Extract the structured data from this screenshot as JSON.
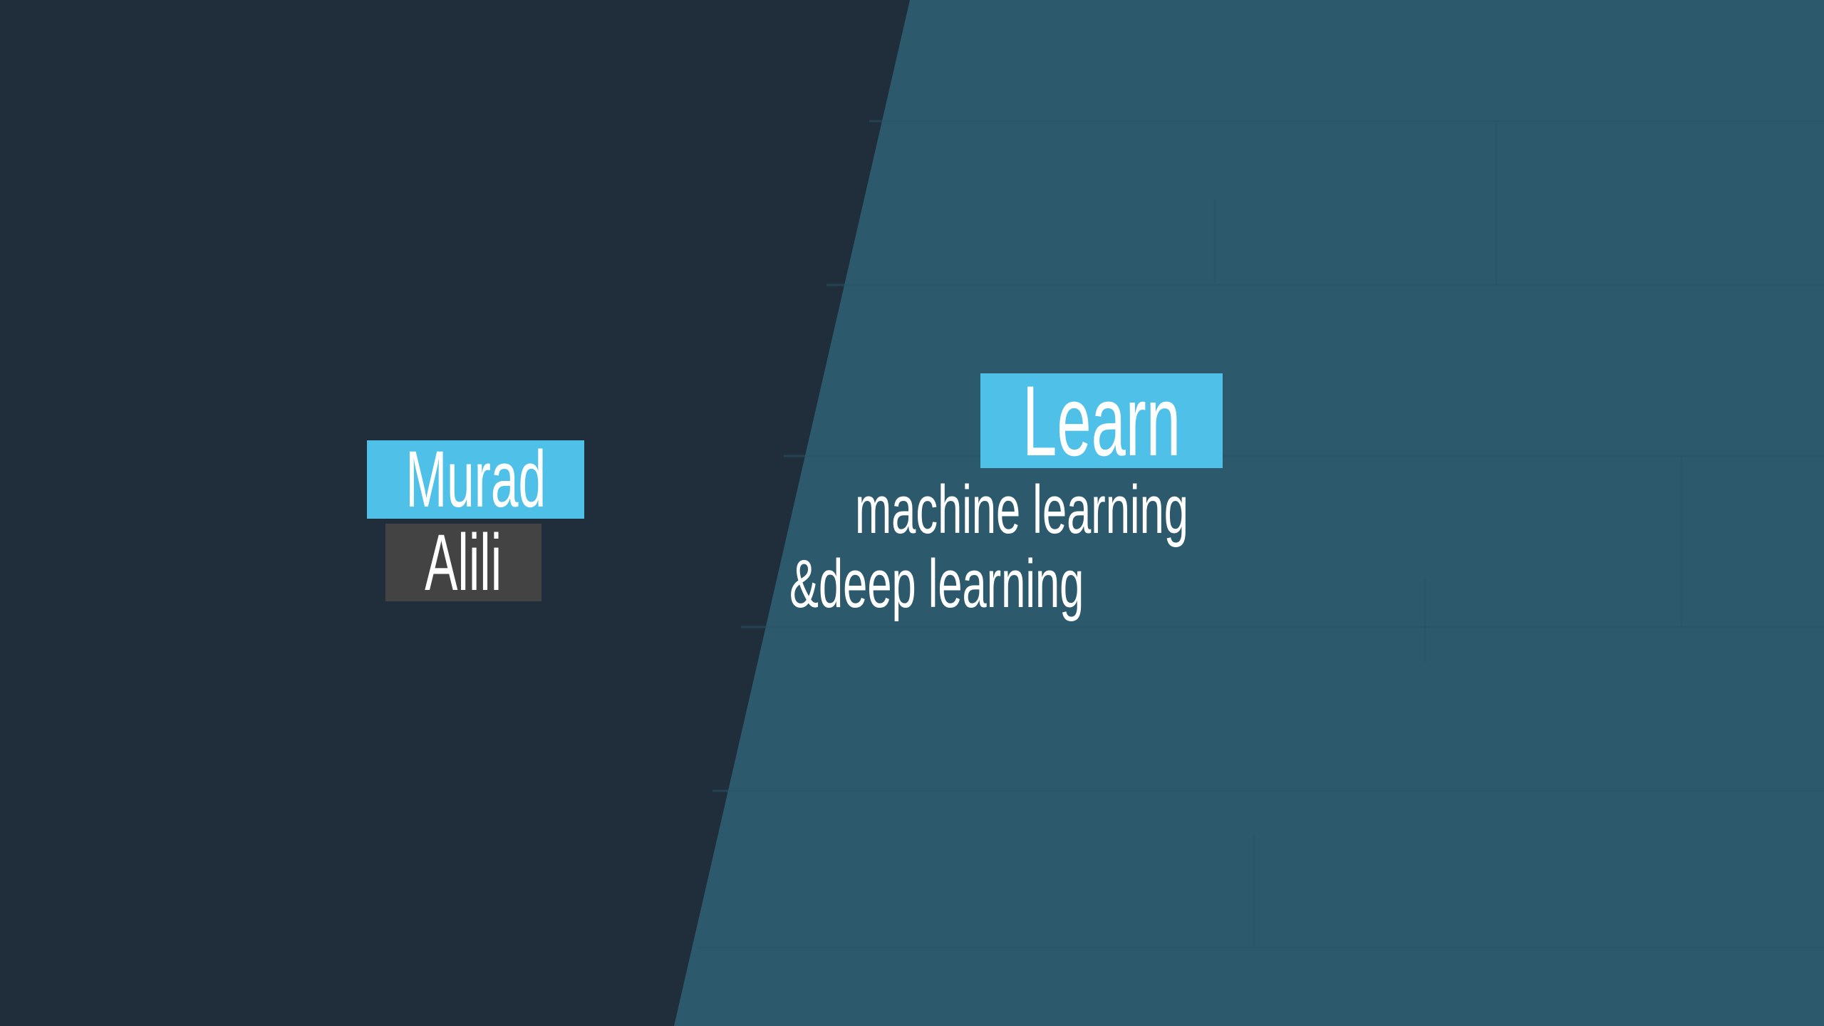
{
  "name": {
    "first": "Murad",
    "last": "Alili"
  },
  "headline": {
    "word": "Learn",
    "line1": "machine learning",
    "line2": "&deep learning"
  },
  "colors": {
    "dark_panel": "#1f2e3a",
    "teal_panel": "#2c5a6c",
    "accent_blue": "#4fc1e9",
    "tag_gray": "#434343",
    "text": "#ffffff"
  }
}
